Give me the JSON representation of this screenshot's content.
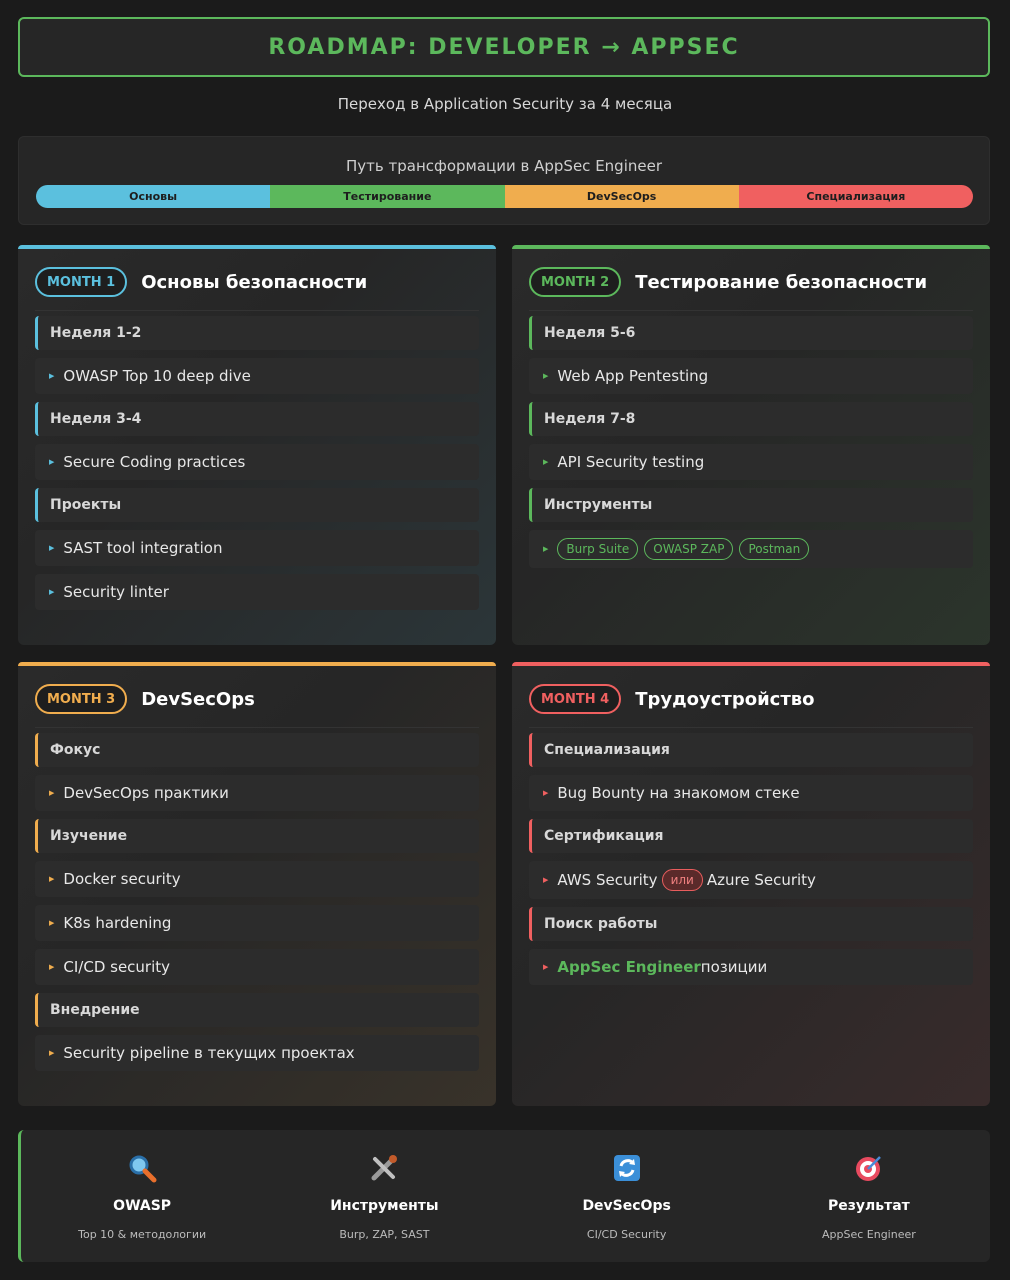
{
  "header": {
    "title": "ROADMAP: DEVELOPER → APPSEC",
    "subtitle": "Переход в Application Security за 4 месяца"
  },
  "path": {
    "title": "Путь трансформации в AppSec Engineer",
    "stages": [
      {
        "label": "Основы",
        "color": "#5bc0de"
      },
      {
        "label": "Тестирование",
        "color": "#5cb85c"
      },
      {
        "label": "DevSecOps",
        "color": "#f0ad4e"
      },
      {
        "label": "Специализация",
        "color": "#f06060"
      }
    ]
  },
  "months": [
    {
      "badge": "MONTH 1",
      "title": "Основы безопасности",
      "color": "#5bc0de",
      "rows": [
        {
          "type": "h",
          "text": "Неделя 1-2"
        },
        {
          "type": "i",
          "text": "OWASP Top 10 deep dive"
        },
        {
          "type": "h",
          "text": "Неделя 3-4"
        },
        {
          "type": "i",
          "text": "Secure Coding practices"
        },
        {
          "type": "h",
          "text": "Проекты"
        },
        {
          "type": "i",
          "text": "SAST tool integration"
        },
        {
          "type": "i",
          "text": "Security linter"
        }
      ]
    },
    {
      "badge": "MONTH 2",
      "title": "Тестирование безопасности",
      "color": "#5cb85c",
      "rows": [
        {
          "type": "h",
          "text": "Неделя 5-6"
        },
        {
          "type": "i",
          "text": "Web App Pentesting"
        },
        {
          "type": "h",
          "text": "Неделя 7-8"
        },
        {
          "type": "i",
          "text": "API Security testing"
        },
        {
          "type": "h",
          "text": "Инструменты"
        },
        {
          "type": "tools",
          "items": [
            "Burp Suite",
            "OWASP ZAP",
            "Postman"
          ]
        }
      ]
    },
    {
      "badge": "MONTH 3",
      "title": "DevSecOps",
      "color": "#f0ad4e",
      "rows": [
        {
          "type": "h",
          "text": "Фокус"
        },
        {
          "type": "i",
          "text": "DevSecOps практики"
        },
        {
          "type": "h",
          "text": "Изучение"
        },
        {
          "type": "i",
          "text": "Docker security"
        },
        {
          "type": "i",
          "text": "K8s hardening"
        },
        {
          "type": "i",
          "text": "CI/CD security"
        },
        {
          "type": "h",
          "text": "Внедрение"
        },
        {
          "type": "i",
          "text": "Security pipeline в текущих проектах"
        }
      ]
    },
    {
      "badge": "MONTH 4",
      "title": "Трудоустройство",
      "color": "#f06060",
      "rows": [
        {
          "type": "h",
          "text": "Специализация"
        },
        {
          "type": "i",
          "text": "Bug Bounty на знакомом стеке"
        },
        {
          "type": "h",
          "text": "Сертификация"
        },
        {
          "type": "or",
          "left": "AWS Security",
          "mid": "или",
          "right": "Azure Security"
        },
        {
          "type": "h",
          "text": "Поиск работы"
        },
        {
          "type": "hl",
          "strong": "AppSec Engineer",
          "rest": "позиции"
        }
      ]
    }
  ],
  "footer": [
    {
      "icon": "magnifier-icon",
      "title": "OWASP",
      "sub": "Top 10 & методологии"
    },
    {
      "icon": "tools-icon",
      "title": "Инструменты",
      "sub": "Burp, ZAP, SAST"
    },
    {
      "icon": "cycle-icon",
      "title": "DevSecOps",
      "sub": "CI/CD Security"
    },
    {
      "icon": "target-icon",
      "title": "Результат",
      "sub": "AppSec Engineer"
    }
  ]
}
